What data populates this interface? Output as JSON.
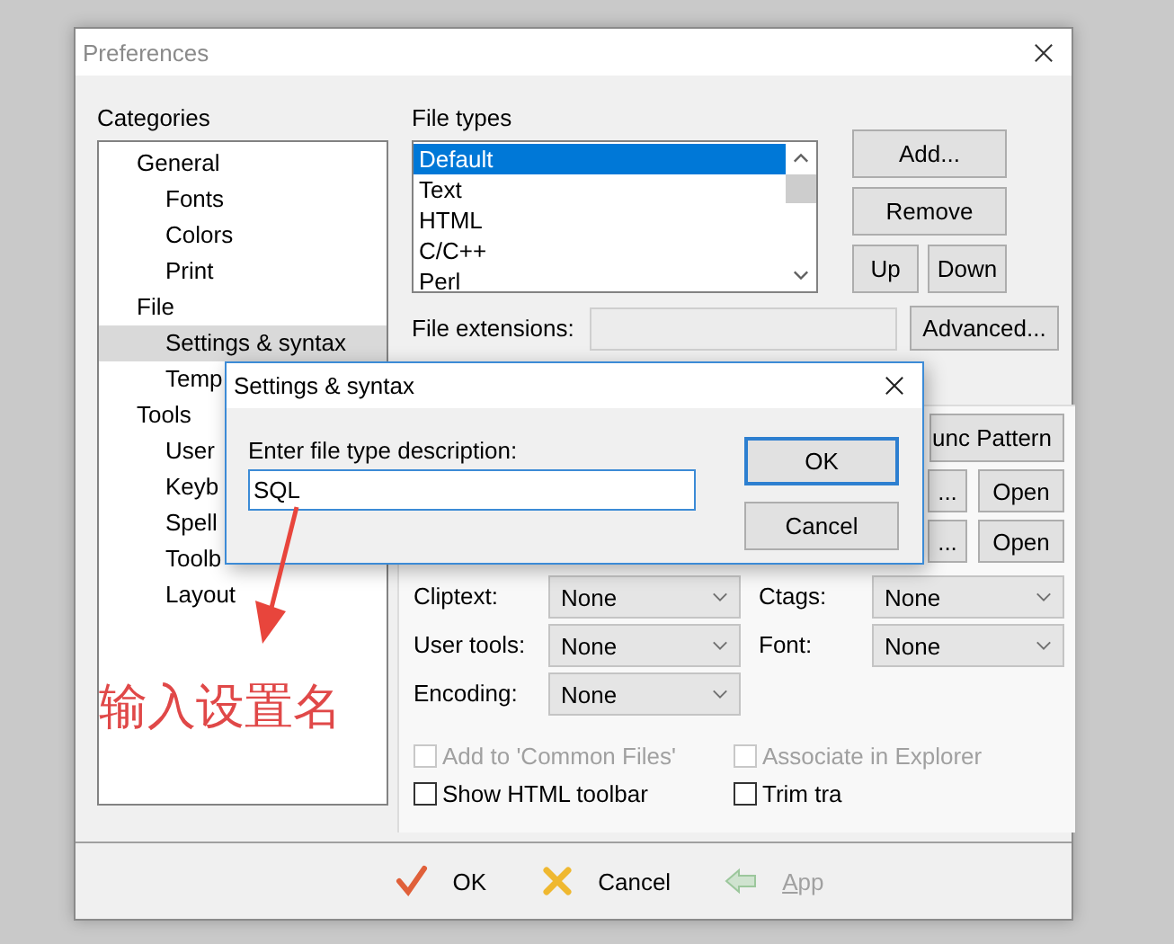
{
  "window": {
    "title": "Preferences"
  },
  "categories": {
    "label": "Categories",
    "items": [
      {
        "label": "General",
        "selected": false,
        "children": [
          {
            "label": "Fonts",
            "selected": false
          },
          {
            "label": "Colors",
            "selected": false
          },
          {
            "label": "Print",
            "selected": false
          }
        ]
      },
      {
        "label": "File",
        "selected": false,
        "children": [
          {
            "label": "Settings & syntax",
            "selected": true
          },
          {
            "label": "Temp",
            "selected": false
          }
        ]
      },
      {
        "label": "Tools",
        "selected": false,
        "children": [
          {
            "label": "User",
            "selected": false
          },
          {
            "label": "Keyb",
            "selected": false
          },
          {
            "label": "Spell",
            "selected": false
          },
          {
            "label": "Toolb",
            "selected": false
          },
          {
            "label": "Layout",
            "selected": false
          }
        ]
      }
    ]
  },
  "file_types": {
    "label": "File types",
    "items": [
      {
        "label": "Default",
        "selected": true
      },
      {
        "label": "Text",
        "selected": false
      },
      {
        "label": "HTML",
        "selected": false
      },
      {
        "label": "C/C++",
        "selected": false
      },
      {
        "label": "Perl",
        "selected": false
      }
    ]
  },
  "file_type_buttons": {
    "add": "Add...",
    "remove": "Remove",
    "up": "Up",
    "down": "Down"
  },
  "file_extensions": {
    "label": "File extensions:",
    "button": "Advanced..."
  },
  "func_pattern_button": "unc Pattern",
  "browse_rows": [
    {
      "dots": "...",
      "open": "Open"
    },
    {
      "dots": "...",
      "open": "Open"
    }
  ],
  "options": [
    {
      "label": "Cliptext:",
      "value": "None"
    },
    {
      "label": "Ctags:",
      "value": "None"
    },
    {
      "label": "User tools:",
      "value": "None"
    },
    {
      "label": "Font:",
      "value": "None"
    },
    {
      "label": "Encoding:",
      "value": "None"
    }
  ],
  "checkboxes": [
    {
      "label": "Add to 'Common Files'",
      "checked": false,
      "disabled": true
    },
    {
      "label": "Associate in Explorer",
      "checked": false,
      "disabled": true
    },
    {
      "label": "Show HTML toolbar",
      "checked": false,
      "disabled": false
    },
    {
      "label": "Trim tra",
      "checked": false,
      "disabled": false
    }
  ],
  "footer_buttons": [
    {
      "kind": "ok",
      "label": "OK",
      "disabled": false
    },
    {
      "kind": "cancel",
      "label": "Cancel",
      "disabled": false
    },
    {
      "kind": "apply",
      "label": "App",
      "disabled": true
    }
  ],
  "dialog": {
    "title": "Settings & syntax",
    "prompt": "Enter file type description:",
    "value": "SQL",
    "buttons": [
      {
        "label": "OK",
        "default": true
      },
      {
        "label": "Cancel",
        "default": false
      }
    ]
  },
  "annotation": {
    "text": "输入设置名"
  }
}
